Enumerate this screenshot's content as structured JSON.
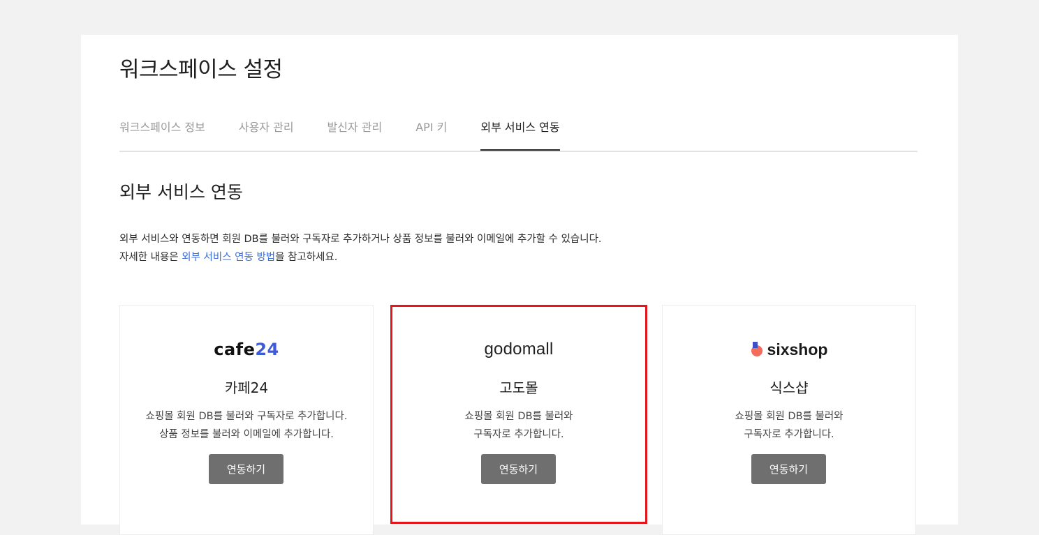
{
  "page": {
    "title": "워크스페이스 설정"
  },
  "tabs": [
    {
      "label": "워크스페이스 정보",
      "active": false
    },
    {
      "label": "사용자 관리",
      "active": false
    },
    {
      "label": "발신자 관리",
      "active": false
    },
    {
      "label": "API 키",
      "active": false
    },
    {
      "label": "외부 서비스 연동",
      "active": true
    }
  ],
  "section": {
    "title": "외부 서비스 연동",
    "description_line1": "외부 서비스와 연동하면 회원 DB를 불러와 구독자로 추가하거나 상품 정보를 불러와 이메일에 추가할 수 있습니다.",
    "description_line2_prefix": "자세한 내용은 ",
    "description_link": "외부 서비스 연동 방법",
    "description_line2_suffix": "을 참고하세요."
  },
  "cards": [
    {
      "logo_text": "cafe",
      "logo_number": "24",
      "name": "카페24",
      "desc_line1": "쇼핑몰 회원 DB를 불러와 구독자로 추가합니다.",
      "desc_line2": "상품 정보를 불러와 이메일에 추가합니다.",
      "button_label": "연동하기"
    },
    {
      "logo_text": "godomall",
      "name": "고도몰",
      "desc_line1": "쇼핑몰 회원 DB를 불러와",
      "desc_line2": "구독자로 추가합니다.",
      "button_label": "연동하기",
      "highlighted": true
    },
    {
      "logo_text": "sixshop",
      "name": "식스샵",
      "desc_line1": "쇼핑몰 회원 DB를 불러와",
      "desc_line2": "구독자로 추가합니다.",
      "button_label": "연동하기"
    }
  ],
  "colors": {
    "link": "#3b6fe0",
    "button_bg": "#6f6f6f",
    "highlight_border": "#e3161c",
    "cafe24_accent": "#3d5ad8"
  }
}
